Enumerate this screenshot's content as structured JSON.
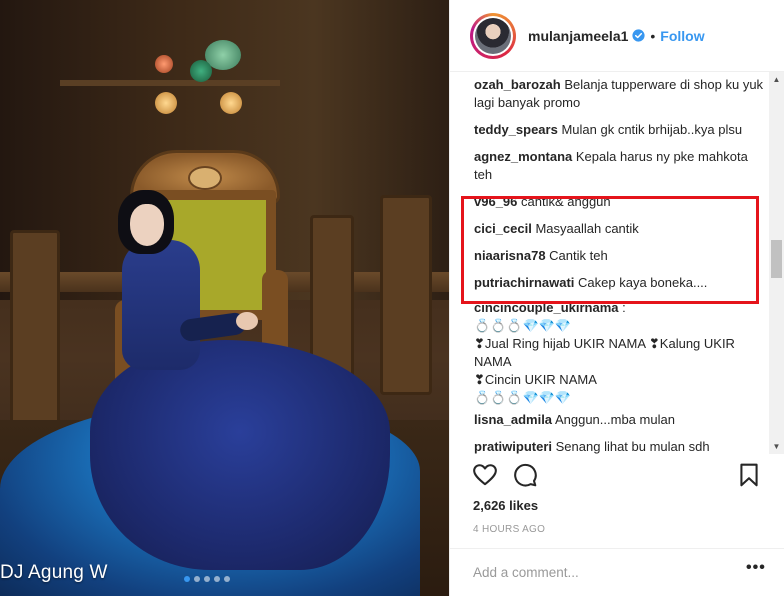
{
  "photo": {
    "watermark": "DJ Agung W",
    "carousel_count": 5,
    "carousel_active": 1
  },
  "header": {
    "username": "mulanjameela1",
    "separator": "•",
    "follow_label": "Follow"
  },
  "comments": [
    {
      "user": "ozah_barozah",
      "text": "Belanja tupperware di shop ku yuk lagi banyak promo"
    },
    {
      "user": "teddy_spears",
      "text": "Mulan gk cntik brhijab..kya plsu"
    },
    {
      "user": "agnez_montana",
      "text": "Kepala harus ny pke mahkota teh"
    },
    {
      "user": "v96_96",
      "text": "cantik& anggun"
    },
    {
      "user": "cici_cecil",
      "text": "Masyaallah cantik"
    },
    {
      "user": "niaarisna78",
      "text": "Cantik teh"
    },
    {
      "user": "putriachirnawati",
      "text": "Cakep kaya boneka...."
    },
    {
      "user": "cincincouple_ukirnama",
      "text": ":"
    },
    {
      "user": "",
      "text": "💍💍💍💎💎💎"
    },
    {
      "user": "",
      "text": "❣Jual Ring hijab UKIR NAMA ❣Kalung UKIR NAMA"
    },
    {
      "user": "",
      "text": "❣Cincin UKIR NAMA"
    },
    {
      "user": "",
      "text": "💍💍💍💎💎💎"
    },
    {
      "user": "lisna_admila",
      "text": "Anggun...mba mulan"
    },
    {
      "user": "pratiwiputeri",
      "text": "Senang lihat bu mulan sdh"
    }
  ],
  "likes": "2,626 likes",
  "timestamp": "4 HOURS AGO",
  "add_comment": {
    "placeholder": "Add a comment...",
    "more_label": "•••"
  },
  "colors": {
    "accent": "#3897f0",
    "highlight": "#e5141b"
  }
}
